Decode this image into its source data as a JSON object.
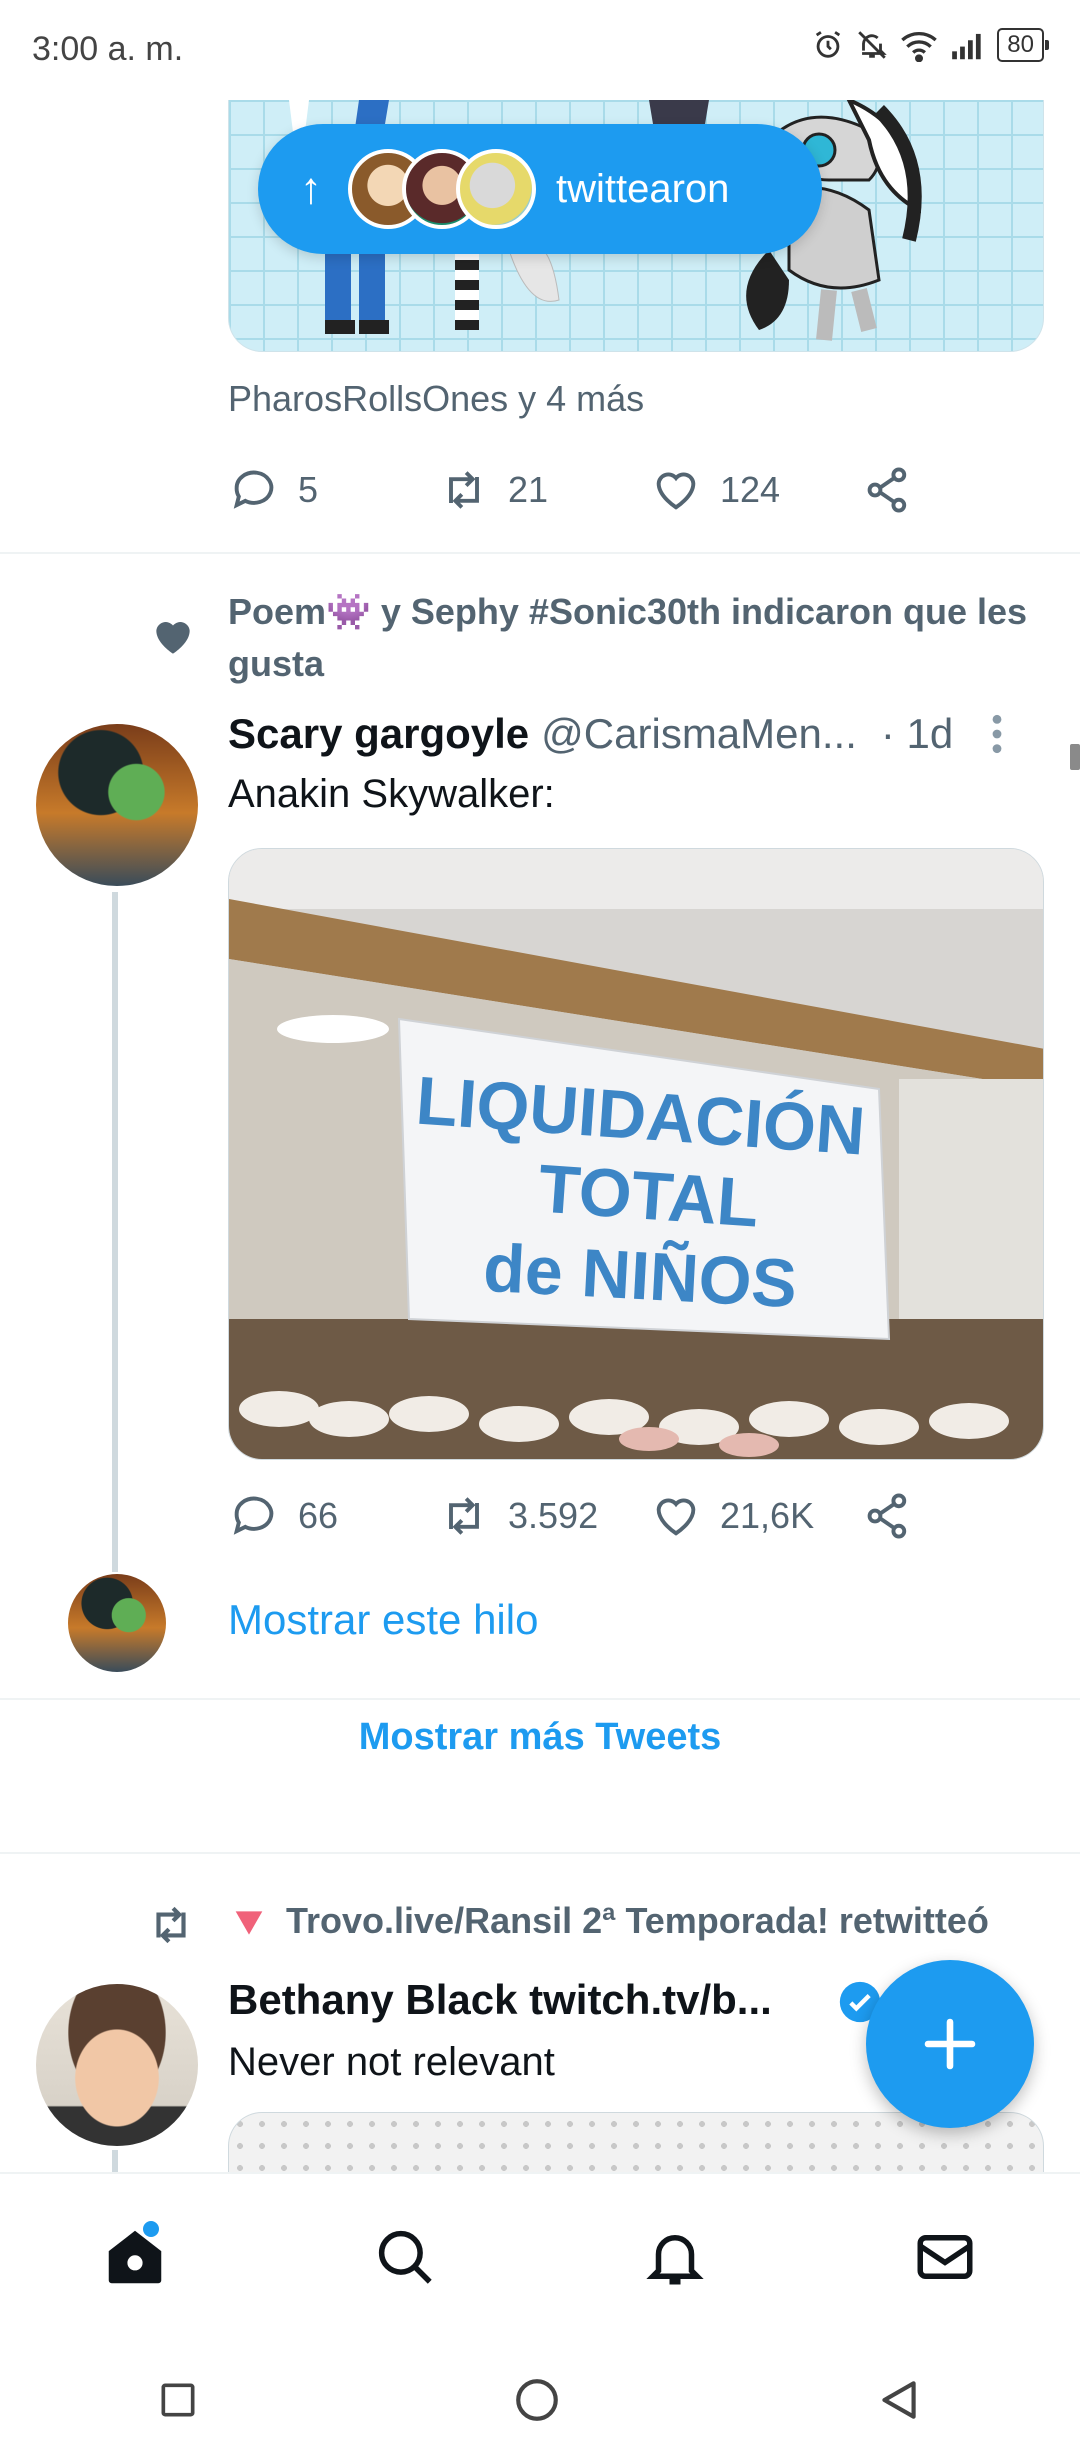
{
  "status_bar": {
    "time": "3:00 a. m.",
    "battery": "80",
    "icons": [
      "alarm-icon",
      "mute-icon",
      "wifi-icon",
      "signal-icon"
    ]
  },
  "previous_tweet": {
    "new_tweets_pill": {
      "label": "twittearon",
      "arrow": "↑"
    },
    "liked_by": "PharosRollsOnes y 4 más",
    "actions": {
      "replies": "5",
      "retweets": "21",
      "likes": "124"
    }
  },
  "tweet": {
    "context": "Poem👾 y Sephy #Sonic30th indicaron que les gusta",
    "author_name": "Scary gargoyle",
    "author_handle": "@CarismaMen...",
    "time": "· 1d",
    "text": "Anakin Skywalker:",
    "image_sign": {
      "line1": "LIQUIDACIÓN",
      "line2": "TOTAL",
      "line3": "de NIÑOS"
    },
    "actions": {
      "replies": "66",
      "retweets": "3.592",
      "likes": "21,6K"
    },
    "show_thread": "Mostrar este hilo"
  },
  "show_more": "Mostrar más Tweets",
  "next_tweet": {
    "context": "Trovo.live/Ransil 2ª Temporada! retwitteó",
    "author_name": "Bethany Black twitch.tv/b...",
    "text": "Never not relevant"
  },
  "colors": {
    "accent": "#1d9bf0",
    "muted": "#536471",
    "divider": "#eff3f4"
  }
}
